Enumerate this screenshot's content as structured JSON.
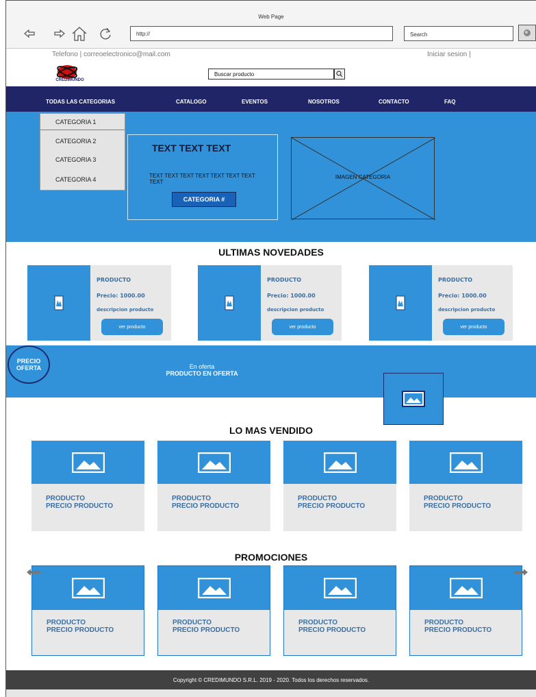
{
  "browser": {
    "window_title": "Web Page",
    "url": "http://",
    "search_label": "Search"
  },
  "topbar": {
    "contact": "Telefono | correoelectronico@mail.com",
    "login": "Iniciar sesion |"
  },
  "brand": {
    "logo_text": "CREDIMUNDO",
    "search_placeholder": "Buscar producto"
  },
  "nav": {
    "items": [
      "TODAS LAS CATEGORIAS",
      "CATALOGO",
      "EVENTOS",
      "NOSOTROS",
      "CONTACTO",
      "FAQ"
    ]
  },
  "category_menu": [
    "CATEGORIA 1",
    "CATEGORIA 2",
    "CATEGORIA 3",
    "CATEGORIA 4"
  ],
  "hero": {
    "title": "TEXT TEXT TEXT",
    "text": "TEXT TEXT TEXT TEXT TEXT TEXT TEXT TEXT",
    "button": "CATEGORIA #",
    "image_label": "IMAGEN CATEGORIA"
  },
  "novedades": {
    "title": "ULTIMAS NOVEDADES",
    "cards": [
      {
        "name": "PRODUCTO",
        "price": "Precio: 1000.00",
        "desc": "descripcion producto",
        "button": "ver producto"
      },
      {
        "name": "PRODUCTO",
        "price": "Precio: 1000.00",
        "desc": "descripcion producto",
        "button": "ver producto"
      },
      {
        "name": "PRODUCTO",
        "price": "Precio: 1000.00",
        "desc": "descripcion producto",
        "button": "ver producto"
      }
    ]
  },
  "offer": {
    "badge": "PRECIO OFERTA",
    "line1": "En oferta",
    "line2": "PRODUCTO EN OFERTA"
  },
  "mas_vendido": {
    "title": "LO MAS VENDIDO",
    "cards": [
      {
        "name": "PRODUCTO",
        "price": "PRECIO PRODUCTO"
      },
      {
        "name": "PRODUCTO",
        "price": "PRECIO PRODUCTO"
      },
      {
        "name": "PRODUCTO",
        "price": "PRECIO PRODUCTO"
      },
      {
        "name": "PRODUCTO",
        "price": "PRECIO PRODUCTO"
      }
    ]
  },
  "promociones": {
    "title": "PROMOCIONES",
    "cards": [
      {
        "name": "PRODUCTO",
        "price": "PRECIO PRODUCTO"
      },
      {
        "name": "PRODUCTO",
        "price": "PRECIO PRODUCTO"
      },
      {
        "name": "PRODUCTO",
        "price": "PRECIO PRODUCTO"
      },
      {
        "name": "PRODUCTO",
        "price": "PRECIO PRODUCTO"
      }
    ]
  },
  "footer": {
    "copyright": "Copyright © CREDIMUNDO S.R.L. 2019 - 2020. Todos los derechos reservados."
  },
  "colors": {
    "navy": "#1f2566",
    "accent_blue": "#3192d9",
    "card_gray": "#e8e8e8",
    "footer": "#414141"
  },
  "icons": [
    "back-icon",
    "forward-icon",
    "home-icon",
    "reload-icon",
    "search-icon",
    "image-placeholder-icon",
    "mobile-image-icon",
    "left-arrow-icon",
    "right-arrow-icon"
  ]
}
